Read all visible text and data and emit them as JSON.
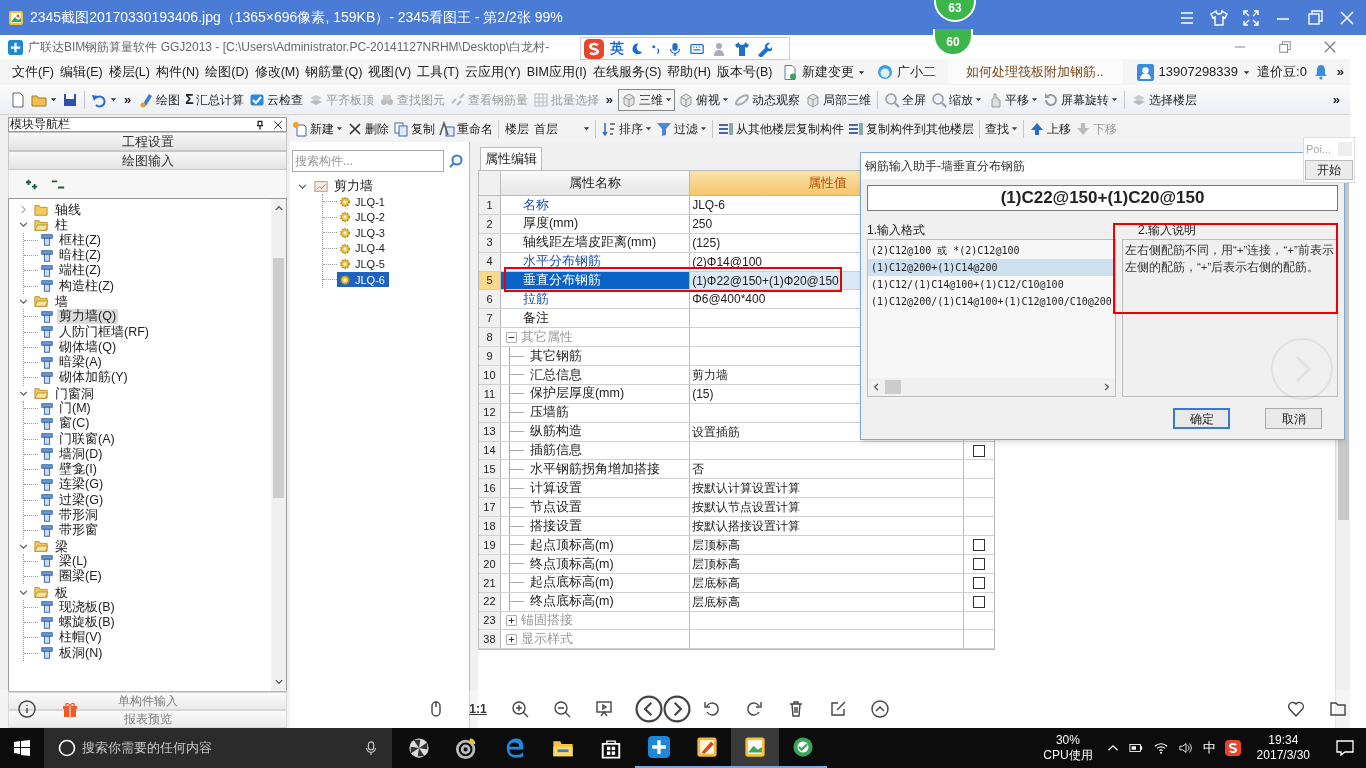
{
  "viewer": {
    "title": "2345截图20170330193406.jpg（1365×696像素, 159KB）- 2345看图王 - 第2/2张 99%",
    "badge": "63",
    "zoom_label": "1:1"
  },
  "app": {
    "title": "广联达BIM钢筋算量软件 GGJ2013 - [C:\\Users\\Administrator.PC-20141127NRHM\\Desktop\\白龙村-",
    "badge": "60"
  },
  "ime_bar": {
    "mode": "英"
  },
  "menu": [
    "文件(F)",
    "编辑(E)",
    "楼层(L)",
    "构件(N)",
    "绘图(D)",
    "修改(M)",
    "钢筋量(Q)",
    "视图(V)",
    "工具(T)",
    "云应用(Y)",
    "BIM应用(I)",
    "在线服务(S)",
    "帮助(H)",
    "版本号(B)"
  ],
  "menu_extras": [
    {
      "label": "新建变更",
      "dropdown": true
    },
    {
      "label": "广小二",
      "dropdown": false
    }
  ],
  "news": "如何处理筏板附加钢筋..",
  "account": {
    "phone": "13907298339",
    "points": "遣价豆:0",
    "overflow": "»"
  },
  "toolbar": [
    {
      "kind": "icon",
      "dropdown": false
    },
    {
      "kind": "icon",
      "dropdown": true
    },
    {
      "kind": "icon",
      "dropdown": false
    },
    {
      "kind": "separator"
    },
    {
      "kind": "icon",
      "dropdown": true
    },
    {
      "kind": "overflow",
      "label": "»"
    },
    {
      "kind": "button",
      "label": "绘图",
      "dropdown": false,
      "disabled": false
    },
    {
      "kind": "button",
      "label": "汇总计算",
      "glyph": "Σ",
      "dropdown": false,
      "disabled": false
    },
    {
      "kind": "button",
      "label": "云检查",
      "dropdown": false,
      "disabled": false
    },
    {
      "kind": "button",
      "label": "平齐板顶",
      "dropdown": false,
      "disabled": true
    },
    {
      "kind": "button",
      "label": "查找图元",
      "dropdown": false,
      "disabled": true
    },
    {
      "kind": "button",
      "label": "查看钢筋量",
      "dropdown": false,
      "disabled": true
    },
    {
      "kind": "button",
      "label": "批量选择",
      "dropdown": false,
      "disabled": true
    },
    {
      "kind": "overflow",
      "label": "»"
    },
    {
      "kind": "combo",
      "label": "三维",
      "dropdown": true,
      "disabled": false
    },
    {
      "kind": "button",
      "label": "俯视",
      "dropdown": true,
      "disabled": false
    },
    {
      "kind": "button",
      "label": "动态观察",
      "dropdown": false,
      "disabled": false
    },
    {
      "kind": "button",
      "label": "局部三维",
      "dropdown": false,
      "disabled": false
    },
    {
      "kind": "separator"
    },
    {
      "kind": "button",
      "label": "全屏",
      "dropdown": false,
      "disabled": false
    },
    {
      "kind": "button",
      "label": "缩放",
      "dropdown": true,
      "disabled": false
    },
    {
      "kind": "button",
      "label": "平移",
      "dropdown": true,
      "disabled": false
    },
    {
      "kind": "button",
      "label": "屏幕旋转",
      "dropdown": true,
      "disabled": false
    },
    {
      "kind": "separator"
    },
    {
      "kind": "button",
      "label": "选择楼层",
      "dropdown": false,
      "disabled": false
    },
    {
      "kind": "overflow_end",
      "label": "»"
    }
  ],
  "module_nav": {
    "title": "模块导航栏",
    "buttons": [
      "工程设置",
      "绘图输入"
    ],
    "tree": [
      {
        "label": "轴线",
        "expanded": false
      },
      {
        "label": "柱",
        "expanded": true,
        "children": [
          {
            "label": "框柱(Z)",
            "selected": false
          },
          {
            "label": "暗柱(Z)",
            "selected": false
          },
          {
            "label": "端柱(Z)",
            "selected": false
          },
          {
            "label": "构造柱(Z)",
            "selected": false
          }
        ]
      },
      {
        "label": "墙",
        "expanded": true,
        "children": [
          {
            "label": "剪力墙(Q)",
            "selected": true
          },
          {
            "label": "人防门框墙(RF)",
            "selected": false
          },
          {
            "label": "砌体墙(Q)",
            "selected": false
          },
          {
            "label": "暗梁(A)",
            "selected": false
          },
          {
            "label": "砌体加筋(Y)",
            "selected": false
          }
        ]
      },
      {
        "label": "门窗洞",
        "expanded": true,
        "children": [
          {
            "label": "门(M)",
            "selected": false
          },
          {
            "label": "窗(C)",
            "selected": false
          },
          {
            "label": "门联窗(A)",
            "selected": false
          },
          {
            "label": "墙洞(D)",
            "selected": false
          },
          {
            "label": "壁龛(I)",
            "selected": false
          },
          {
            "label": "连梁(G)",
            "selected": false
          },
          {
            "label": "过梁(G)",
            "selected": false
          },
          {
            "label": "带形洞",
            "selected": false
          },
          {
            "label": "带形窗",
            "selected": false
          }
        ]
      },
      {
        "label": "梁",
        "expanded": true,
        "children": [
          {
            "label": "梁(L)",
            "selected": false
          },
          {
            "label": "圈梁(E)",
            "selected": false
          }
        ]
      },
      {
        "label": "板",
        "expanded": true,
        "children": [
          {
            "label": "现浇板(B)",
            "selected": false
          },
          {
            "label": "螺旋板(B)",
            "selected": false
          },
          {
            "label": "柱帽(V)",
            "selected": false
          },
          {
            "label": "板洞(N)",
            "selected": false
          }
        ]
      }
    ],
    "footer_buttons": [
      "单构件输入",
      "报表预览"
    ]
  },
  "toolbar2": [
    {
      "kind": "button",
      "label": "新建",
      "dropdown": true,
      "disabled": false
    },
    {
      "kind": "button",
      "label": "删除",
      "dropdown": false,
      "disabled": false
    },
    {
      "kind": "button",
      "label": "复制",
      "dropdown": false,
      "disabled": false
    },
    {
      "kind": "button",
      "label": "重命名",
      "dropdown": false,
      "disabled": false
    },
    {
      "kind": "separator"
    },
    {
      "kind": "floor",
      "label": "楼层",
      "value": "首层"
    },
    {
      "kind": "separator"
    },
    {
      "kind": "button",
      "label": "排序",
      "dropdown": true,
      "disabled": false
    },
    {
      "kind": "button",
      "label": "过滤",
      "dropdown": true,
      "disabled": false
    },
    {
      "kind": "separator"
    },
    {
      "kind": "button",
      "label": "从其他楼层复制构件",
      "dropdown": false,
      "disabled": false
    },
    {
      "kind": "button",
      "label": "复制构件到其他楼层",
      "dropdown": false,
      "disabled": false
    },
    {
      "kind": "separator"
    },
    {
      "kind": "button",
      "label": "查找",
      "dropdown": true,
      "disabled": false
    },
    {
      "kind": "separator"
    },
    {
      "kind": "button",
      "label": "上移",
      "dropdown": false,
      "disabled": false
    },
    {
      "kind": "button",
      "label": "下移",
      "dropdown": false,
      "disabled": true
    }
  ],
  "component_list": {
    "search_placeholder": "搜索构件...",
    "tree": {
      "label": "剪力墙",
      "expanded": true,
      "children": [
        {
          "label": "JLQ-1",
          "selected": false
        },
        {
          "label": "JLQ-2",
          "selected": false
        },
        {
          "label": "JLQ-3",
          "selected": false
        },
        {
          "label": "JLQ-4",
          "selected": false
        },
        {
          "label": "JLQ-5",
          "selected": false
        },
        {
          "label": "JLQ-6",
          "selected": true
        }
      ]
    }
  },
  "property_editor": {
    "tab": "属性编辑",
    "columns": [
      "属性名称",
      "属性值"
    ],
    "rows": [
      {
        "num": "1",
        "name": "名称",
        "value": "JLQ-6",
        "kind": "public",
        "selected": false
      },
      {
        "num": "2",
        "name": "厚度(mm)",
        "value": "250",
        "kind": "private",
        "selected": false
      },
      {
        "num": "3",
        "name": "轴线距左墙皮距离(mm)",
        "value": "(125)",
        "kind": "private",
        "selected": false
      },
      {
        "num": "4",
        "name": "水平分布钢筋",
        "value": "(2)Φ14@100",
        "kind": "public",
        "selected": false
      },
      {
        "num": "5",
        "name": "垂直分布钢筋",
        "value": "(1)Φ22@150+(1)Φ20@150",
        "kind": "public",
        "selected": true
      },
      {
        "num": "6",
        "name": "拉筋",
        "value": "Φ6@400*400",
        "kind": "public",
        "selected": false
      },
      {
        "num": "7",
        "name": "备注",
        "kind": "private",
        "selected": false
      },
      {
        "num": "8",
        "name": "其它属性",
        "kind": "group",
        "expanded": true,
        "selected": false,
        "children": [
          {
            "num": "9",
            "name": "其它钢筋",
            "kind": "private",
            "selected": false
          },
          {
            "num": "10",
            "name": "汇总信息",
            "value": "剪力墙",
            "kind": "private",
            "selected": false
          },
          {
            "num": "11",
            "name": "保护层厚度(mm)",
            "value": "(15)",
            "kind": "private",
            "selected": false
          },
          {
            "num": "12",
            "name": "压墙筋",
            "kind": "private",
            "selected": false
          },
          {
            "num": "13",
            "name": "纵筋构造",
            "value": "设置插筋",
            "kind": "private",
            "selected": false
          },
          {
            "num": "14",
            "name": "插筋信息",
            "kind": "private",
            "selected": false,
            "checked": false
          },
          {
            "num": "15",
            "name": "水平钢筋拐角增加搭接",
            "value": "否",
            "kind": "private",
            "selected": false
          },
          {
            "num": "16",
            "name": "计算设置",
            "value": "按默认计算设置计算",
            "kind": "private",
            "selected": false
          },
          {
            "num": "17",
            "name": "节点设置",
            "value": "按默认节点设置计算",
            "kind": "private",
            "selected": false
          },
          {
            "num": "18",
            "name": "搭接设置",
            "value": "按默认搭接设置计算",
            "kind": "private",
            "selected": false
          },
          {
            "num": "19",
            "name": "起点顶标高(m)",
            "value": "层顶标高",
            "kind": "private",
            "selected": false,
            "checked": false
          },
          {
            "num": "20",
            "name": "终点顶标高(m)",
            "value": "层顶标高",
            "kind": "private",
            "selected": false,
            "checked": false
          },
          {
            "num": "21",
            "name": "起点底标高(m)",
            "value": "层底标高",
            "kind": "private",
            "selected": false,
            "checked": false
          },
          {
            "num": "22",
            "name": "终点底标高(m)",
            "value": "层底标高",
            "kind": "private",
            "selected": false,
            "checked": false
          }
        ]
      },
      {
        "num": "23",
        "name": "锚固搭接",
        "kind": "group",
        "expanded": false,
        "selected": false
      },
      {
        "num": "38",
        "name": "显示样式",
        "kind": "group",
        "expanded": false,
        "selected": false
      }
    ]
  },
  "dialog": {
    "title": "钢筋输入助手-墙垂直分布钢筋",
    "formula": "(1)C22@150+(1)C20@150",
    "format_label": "1.输入格式",
    "formats": [
      {
        "text": "(2)C12@100 或 *(2)C12@100",
        "selected": false
      },
      {
        "text": "(1)C12@200+(1)C14@200",
        "selected": true
      },
      {
        "text": "(1)C12/(1)C14@100+(1)C12/C10@100",
        "selected": false
      },
      {
        "text": "(1)C12@200/(1)C14@100+(1)C12@100/C10@200",
        "selected": false
      }
    ],
    "note_label": "2.输入说明",
    "note": "左右侧配筋不同，用“+”连接，“+”前表示左侧的配筋，“+”后表示右侧的配筋。",
    "buttons": [
      "确定",
      "取消"
    ]
  },
  "mini_window": {
    "title": "Poi...",
    "button": "开始"
  },
  "taskbar": {
    "search_placeholder": "搜索你需要的任何内容",
    "apps": [
      {
        "running": false,
        "selected": false
      },
      {
        "running": false,
        "selected": false
      },
      {
        "running": false,
        "selected": false
      },
      {
        "running": false,
        "selected": false
      },
      {
        "running": false,
        "selected": false
      },
      {
        "running": true,
        "selected": false
      },
      {
        "running": true,
        "selected": false
      },
      {
        "running": true,
        "selected": true
      },
      {
        "running": true,
        "selected": false
      }
    ],
    "cpu_value": "30%",
    "cpu_label": "CPU使用",
    "ime": "中",
    "time": "19:34",
    "date": "2017/3/30"
  }
}
